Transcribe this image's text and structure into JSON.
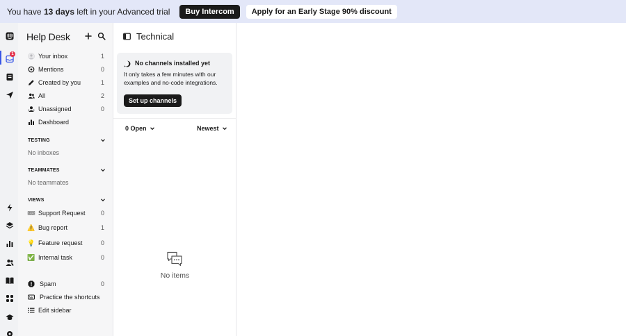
{
  "banner": {
    "text_prefix": "You have ",
    "days": "13 days",
    "text_suffix": " left in your Advanced trial",
    "buy_label": "Buy Intercom",
    "apply_label": "Apply for an Early Stage 90% discount"
  },
  "rail": {
    "inbox_badge": "1",
    "icons": [
      "intercom-logo-icon",
      "inbox-icon",
      "contacts-book-icon",
      "send-icon",
      "bolt-icon",
      "layers-icon",
      "reports-icon",
      "people-icon",
      "knowledge-book-icon",
      "apps-grid-icon",
      "graduation-cap-icon",
      "settings-icon"
    ]
  },
  "sidebar": {
    "title": "Help Desk",
    "items": [
      {
        "label": "Your inbox",
        "count": "1",
        "icon": "avatar-icon"
      },
      {
        "label": "Mentions",
        "count": "0",
        "icon": "at-icon"
      },
      {
        "label": "Created by you",
        "count": "1",
        "icon": "pencil-icon"
      },
      {
        "label": "All",
        "count": "2",
        "icon": "people-icon"
      },
      {
        "label": "Unassigned",
        "count": "0",
        "icon": "unassigned-icon"
      },
      {
        "label": "Dashboard",
        "count": "",
        "icon": "bar-chart-icon"
      }
    ],
    "testing": {
      "heading": "TESTING",
      "empty": "No inboxes"
    },
    "teammates": {
      "heading": "TEAMMATES",
      "empty": "No teammates"
    },
    "views": {
      "heading": "VIEWS",
      "items": [
        {
          "label": "Support Request",
          "count": "0",
          "emoji": "🎟"
        },
        {
          "label": "Bug report",
          "count": "1",
          "emoji": "⚠️"
        },
        {
          "label": "Feature request",
          "count": "0",
          "emoji": "💡"
        },
        {
          "label": "Internal task",
          "count": "0",
          "emoji": "✅"
        }
      ]
    },
    "footer": [
      {
        "label": "Spam",
        "count": "0",
        "icon": "spam-icon"
      },
      {
        "label": "Practice the shortcuts",
        "count": "",
        "icon": "keyboard-icon"
      },
      {
        "label": "Edit sidebar",
        "count": "",
        "icon": "list-icon"
      }
    ]
  },
  "list": {
    "title": "Technical",
    "card": {
      "title": "No channels installed yet",
      "text": "It only takes a few minutes with our examples and no-code integrations.",
      "button": "Set up channels"
    },
    "filter_open": "0 Open",
    "filter_sort": "Newest",
    "empty": "No items"
  }
}
